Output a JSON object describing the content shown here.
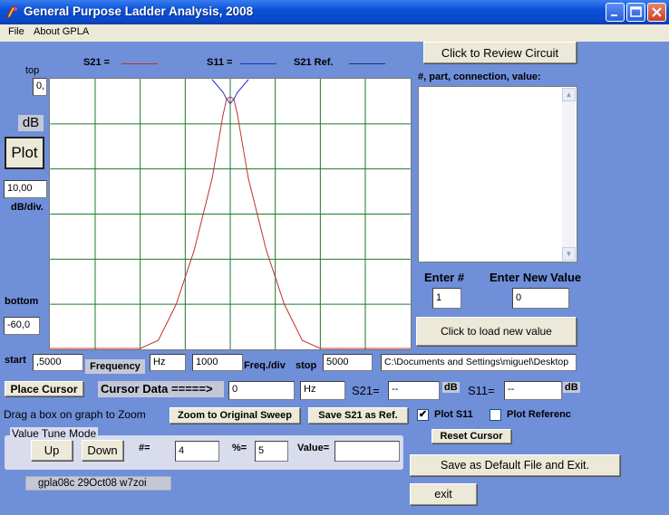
{
  "window": {
    "title": "General Purpose Ladder Analysis, 2008"
  },
  "menu": {
    "file": "File",
    "about": "About GPLA"
  },
  "legend": {
    "s21": "S21  =",
    "s11": "S11  =",
    "s21ref": "S21 Ref.",
    "s21_color": "#c03030",
    "s11_color": "#2030c0",
    "ref_color": "#1a2a90"
  },
  "left_panel": {
    "top_label": "top",
    "top_value": "0,",
    "db_label": "dB",
    "plot_button": "Plot",
    "dbdiv_value": "10,00",
    "dbdiv_label": "dB/div.",
    "bottom_label": "bottom",
    "bottom_value": "-60,0"
  },
  "sweep": {
    "start_label": "start",
    "start_value": ",5000",
    "frequency_button": "Frequency",
    "unit_value": "Hz",
    "freq_div_value": "1000",
    "freq_div_label": "Freq./div",
    "stop_label": "stop",
    "stop_value": "5000",
    "path_value": "C:\\Documents and Settings\\miguel\\Desktop"
  },
  "circuit": {
    "review_button": "Click to Review Circuit",
    "list_header": "#, part, connection, value:",
    "enter_num_label": "Enter #",
    "enter_value_label": "Enter New Value",
    "enter_num_value": "1",
    "enter_value_value": "0",
    "load_button": "Click to load new value"
  },
  "cursor": {
    "place_button": "Place Cursor",
    "data_label": "Cursor Data =====>",
    "freq_value": "0",
    "unit_value": "Hz",
    "s21_label": "S21=",
    "s21_value": "--",
    "s21_unit": "dB",
    "s11_label": "S11=",
    "s11_value": "--",
    "s11_unit": "dB"
  },
  "actions": {
    "drag_hint": "Drag a box on graph to Zoom",
    "zoom_button": "Zoom to Original Sweep",
    "save_ref_button": "Save S21 as Ref.",
    "plot_s11_label": "Plot S11",
    "plot_s11_checked": "✔",
    "plot_ref_label": "Plot Referenc",
    "reset_button": "Reset Cursor",
    "save_default_button": "Save as Default File and Exit.",
    "exit_button": "exit"
  },
  "tune": {
    "legend": "Value Tune Mode",
    "up_button": "Up",
    "down_button": "Down",
    "num_label": "#=",
    "num_value": "4",
    "pct_label": "%=",
    "pct_value": "5",
    "value_label": "Value=",
    "value_value": ""
  },
  "version": "gpla08c  29Oct08 w7zoi",
  "chart_data": {
    "type": "line",
    "x": [
      0,
      0.5,
      1,
      1.5,
      2,
      2.5,
      3,
      3.5,
      4,
      4.5,
      4.8,
      4.9,
      5,
      5.1,
      5.2,
      5.5,
      6,
      6.5,
      7,
      7.5,
      8,
      8.5,
      9,
      9.5,
      10
    ],
    "ylim": [
      -60,
      0
    ],
    "xlim": [
      0,
      10
    ],
    "grid": true,
    "series": [
      {
        "name": "S21",
        "color": "#c03030",
        "values": [
          -60,
          -60,
          -60,
          -60,
          -60,
          -60,
          -58,
          -50,
          -38,
          -22,
          -8,
          -4.5,
          -4,
          -4.5,
          -8,
          -22,
          -38,
          -50,
          -58,
          -60,
          -60,
          -60,
          -60,
          -60,
          -60
        ]
      },
      {
        "name": "S11",
        "color": "#2030c0",
        "values": [
          null,
          null,
          null,
          null,
          null,
          null,
          null,
          null,
          null,
          -0.2,
          -3,
          -4.5,
          -5.5,
          -4.5,
          -3,
          -0.2,
          null,
          null,
          null,
          null,
          null,
          null,
          null,
          null,
          null
        ]
      }
    ]
  }
}
